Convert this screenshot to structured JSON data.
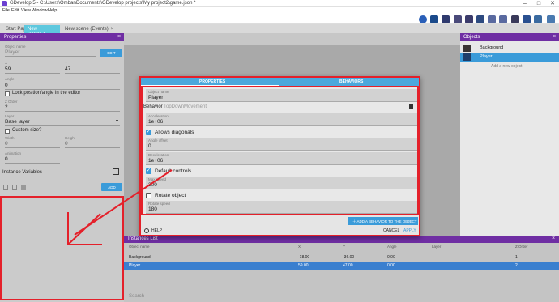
{
  "window": {
    "title": "GDevelop 5 - C:\\Users\\Ombar\\Documents\\GDevelop projects\\My project2\\game.json *"
  },
  "menu": [
    "File",
    "Edit",
    "View",
    "Window",
    "Help"
  ],
  "tabs": [
    "Start Page",
    "New scene",
    "New scene (Events)"
  ],
  "properties": {
    "header": "Properties",
    "object_name_label": "Object name",
    "object_name": "Player",
    "edit_label": "EDIT",
    "x_label": "X",
    "x_value": "59",
    "y_label": "Y",
    "y_value": "47",
    "angle_label": "Angle",
    "angle_value": "0",
    "lock_label": "Lock position/angle in the editor",
    "zorder_label": "Z Order",
    "zorder_value": "2",
    "layer_label": "Layer",
    "layer_value": "Base layer",
    "custom_size_label": "Custom size?",
    "width_label": "Width",
    "width_value": "0",
    "height_label": "Height",
    "height_value": "0",
    "animation_label": "Animation",
    "animation_value": "0",
    "instance_vars_label": "Instance Variables",
    "add_label": "ADD"
  },
  "objects": {
    "header": "Objects",
    "items": [
      "Background",
      "Player"
    ],
    "add_new": "Add a new object"
  },
  "instances": {
    "header": "Instances List",
    "columns": [
      "Object name",
      "X",
      "Y",
      "Angle",
      "Layer",
      "Z Order"
    ],
    "rows": [
      {
        "name": "Background",
        "x": "-18.00",
        "y": "-36.00",
        "angle": "0.00",
        "layer": "",
        "z": "1"
      },
      {
        "name": "Player",
        "x": "59.00",
        "y": "47.00",
        "angle": "0.00",
        "layer": "",
        "z": "2"
      }
    ],
    "search_placeholder": "Search"
  },
  "dialog": {
    "tab_properties": "PROPERTIES",
    "tab_behaviors": "BEHAVIORS",
    "object_name_label": "Object name",
    "object_name": "Player",
    "behavior_label": "Behavior",
    "behavior_name": "TopDownMovement",
    "acceleration_label": "Acceleration",
    "acceleration_value": "1e+06",
    "allows_diagonals": "Allows diagonals",
    "angle_offset_label": "Angle offset",
    "angle_offset_value": "0",
    "deceleration_label": "Deceleration",
    "deceleration_value": "1e+06",
    "default_controls": "Default controls",
    "max_speed_label": "Max speed",
    "max_speed_value": "200",
    "rotate_object": "Rotate object",
    "rotate_speed_label": "Rotate speed",
    "rotate_speed_value": "180",
    "add_behavior_label": "ADD A BEHAVIOR TO THE OBJECT",
    "help_label": "HELP",
    "cancel_label": "CANCEL",
    "apply_label": "APPLY"
  },
  "colors": {
    "accent_purple": "#6f2ea3",
    "accent_blue": "#3a9bd9",
    "tab_cyan": "#5ec8de",
    "annotation_red": "#e4202a"
  }
}
